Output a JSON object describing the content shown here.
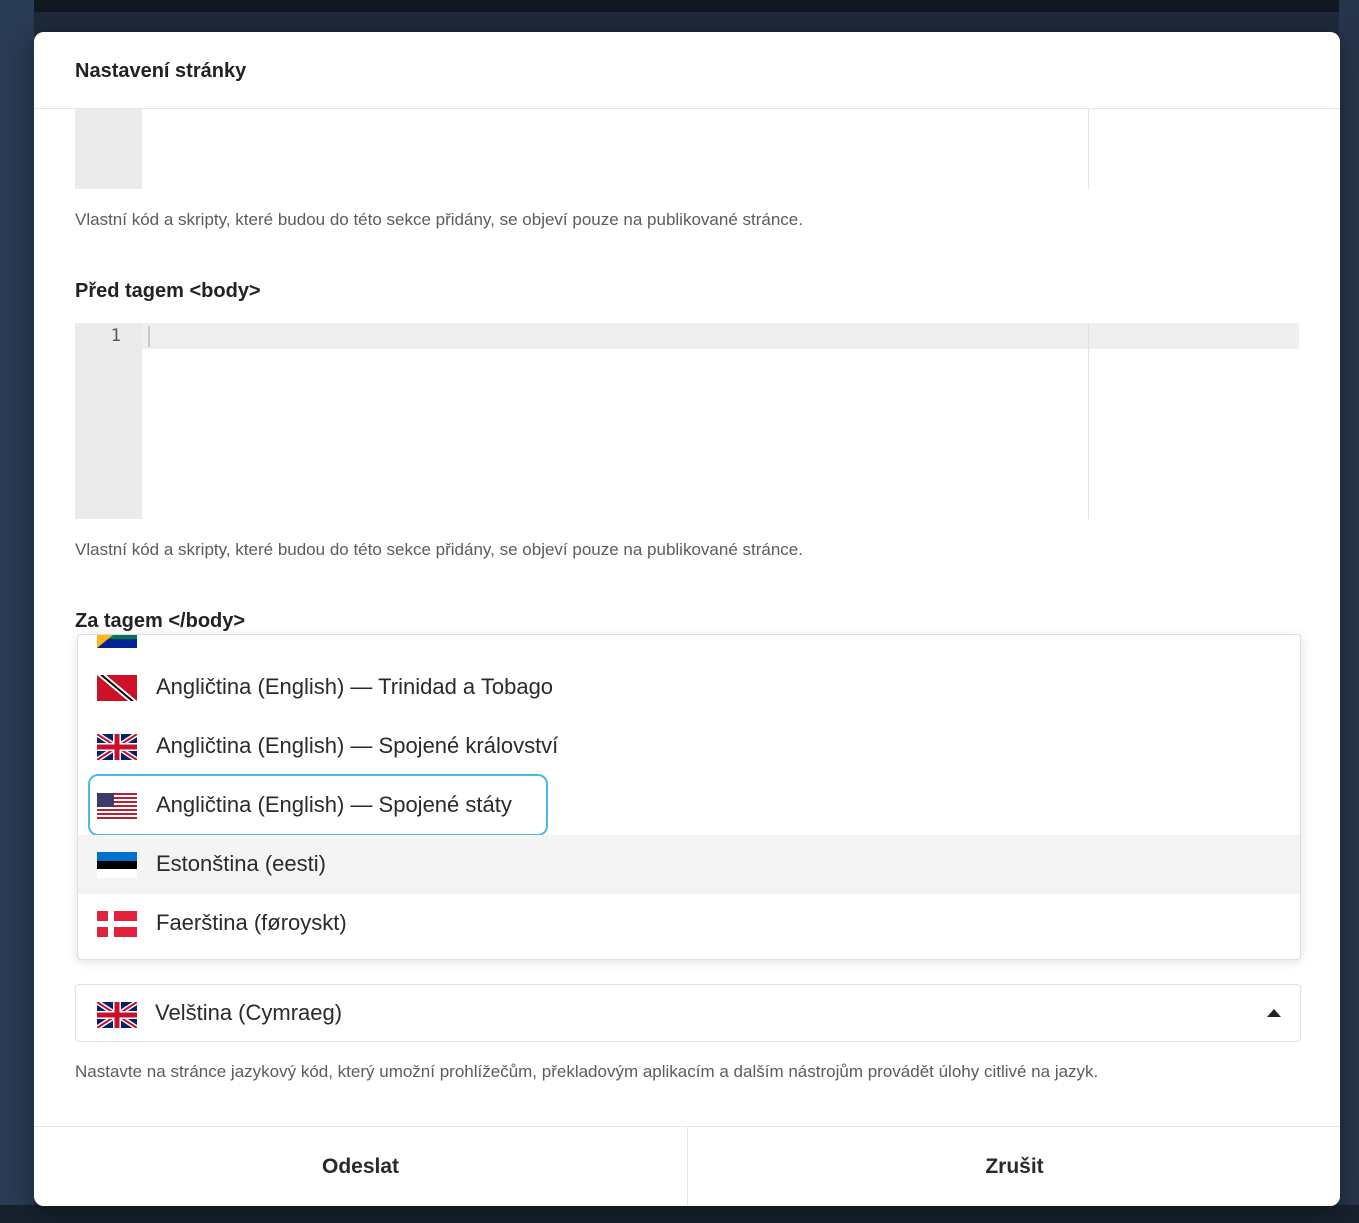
{
  "modal": {
    "title": "Nastavení stránky"
  },
  "sections": {
    "head_help": "Vlastní kód a skripty, které budou do této sekce přidány, se objeví pouze na publikované stránce.",
    "before_body_label": "Před tagem <body>",
    "before_body_line_number": "1",
    "before_body_help": "Vlastní kód a skripty, které budou do této sekce přidány, se objeví pouze na publikované stránce.",
    "after_body_label": "Za tagem </body>"
  },
  "dropdown": {
    "options": [
      {
        "label": "Angličtina (English) — Trinidad a Tobago",
        "flag": "trinidad-tobago-flag"
      },
      {
        "label": "Angličtina (English) — Spojené království",
        "flag": "uk-flag"
      },
      {
        "label": "Angličtina (English) — Spojené státy",
        "flag": "us-flag",
        "focused": true
      },
      {
        "label": "Estonština (eesti)",
        "flag": "estonia-flag",
        "hovered": true
      },
      {
        "label": "Faerština (føroyskt)",
        "flag": "faroe-flag"
      }
    ]
  },
  "language_select": {
    "selected": "Velština (Cymraeg)",
    "flag": "uk-flag",
    "help": "Nastavte na stránce jazykový kód, který umožní prohlížečům, překladovým aplikacím a dalším nástrojům provádět úlohy citlivé na jazyk."
  },
  "footer": {
    "submit_label": "Odeslat",
    "cancel_label": "Zrušit"
  },
  "colors": {
    "focus_ring": "#4db7e8",
    "hover_bg": "#f4f4f4"
  }
}
